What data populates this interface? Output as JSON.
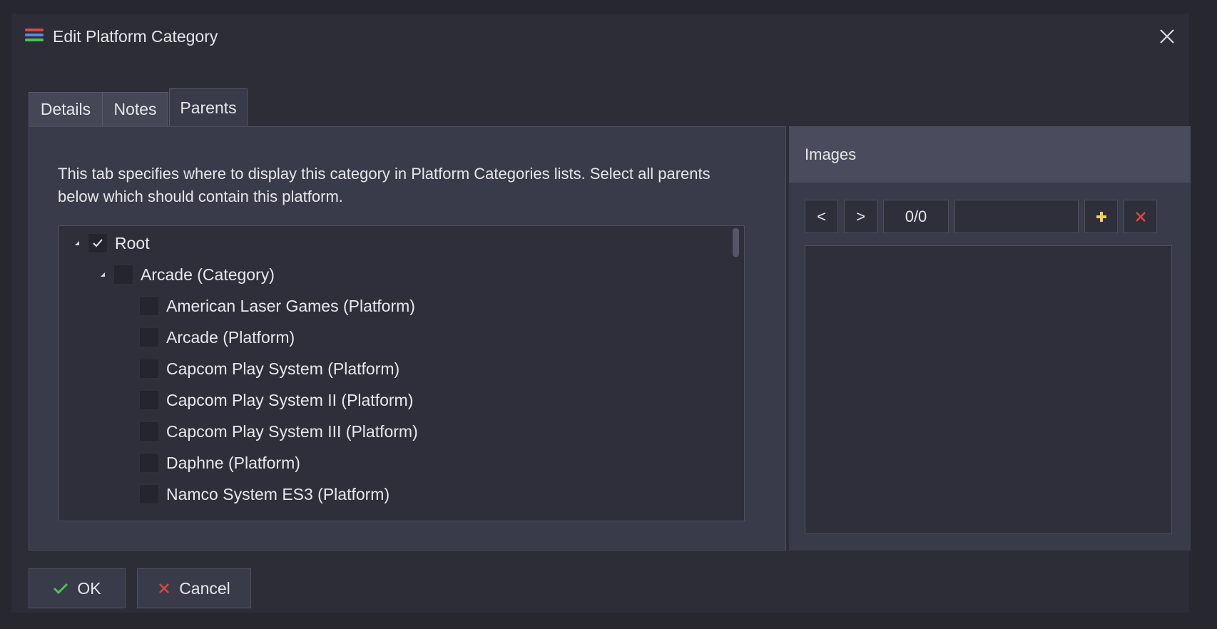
{
  "window": {
    "title": "Edit Platform Category",
    "app_icon": "app-stripes-icon",
    "icon_colors": [
      "#e0463c",
      "#4a8ee0",
      "#4ec24e"
    ]
  },
  "tabs": [
    {
      "label": "Details",
      "active": false
    },
    {
      "label": "Notes",
      "active": false
    },
    {
      "label": "Parents",
      "active": true
    }
  ],
  "parents": {
    "description": "This tab specifies where to display this category in Platform Categories lists. Select all parents below which should contain this platform.",
    "tree": [
      {
        "label": "Root",
        "checked": true,
        "expanded": true
      },
      {
        "label": "Arcade (Category)",
        "checked": false,
        "expanded": true
      },
      {
        "label": "American Laser Games (Platform)",
        "checked": false
      },
      {
        "label": "Arcade (Platform)",
        "checked": false
      },
      {
        "label": "Capcom Play System (Platform)",
        "checked": false
      },
      {
        "label": "Capcom Play System II (Platform)",
        "checked": false
      },
      {
        "label": "Capcom Play System III (Platform)",
        "checked": false
      },
      {
        "label": "Daphne (Platform)",
        "checked": false
      },
      {
        "label": "Namco System ES3 (Platform)",
        "checked": false
      }
    ]
  },
  "images": {
    "header": "Images",
    "prev_label": "<",
    "next_label": ">",
    "counter": "0/0",
    "name_value": "",
    "add_icon": "plus-icon",
    "remove_icon": "x-icon"
  },
  "footer": {
    "ok_label": "OK",
    "cancel_label": "Cancel"
  },
  "colors": {
    "ok_check": "#4ec24e",
    "cancel_x": "#e0463c",
    "add_plus": "#f2d43c"
  }
}
